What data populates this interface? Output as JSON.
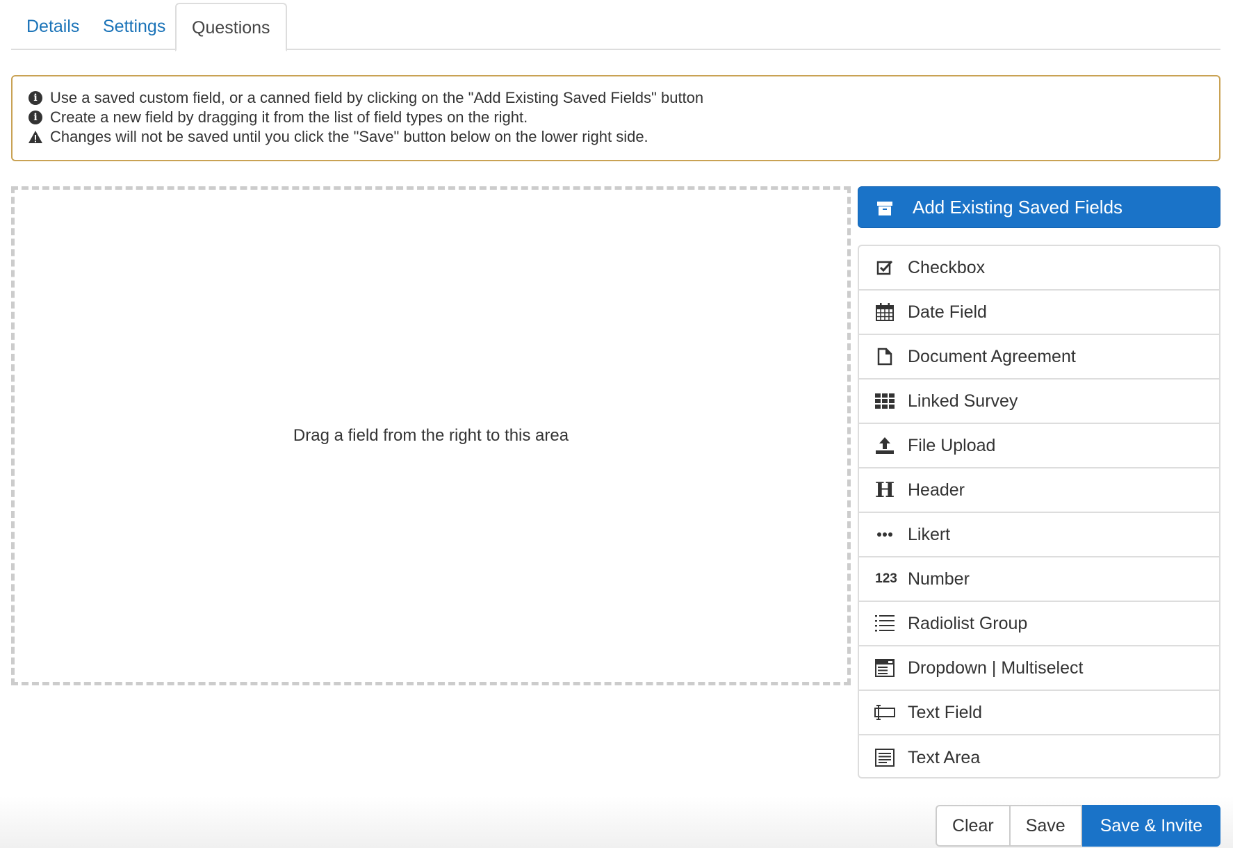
{
  "tabs": [
    {
      "label": "Details",
      "active": false
    },
    {
      "label": "Settings",
      "active": false
    },
    {
      "label": "Questions",
      "active": true
    }
  ],
  "notice": {
    "border_color": "#c9a254",
    "lines": [
      {
        "icon": "info-circle-icon",
        "text": "Use a saved custom field, or a canned field by clicking on the \"Add Existing Saved Fields\" button"
      },
      {
        "icon": "info-circle-icon",
        "text": "Create a new field by dragging it from the list of field types on the right."
      },
      {
        "icon": "warning-icon",
        "text": "Changes will not be saved until you click the \"Save\" button below on the lower right side."
      }
    ]
  },
  "dropzone": {
    "text": "Drag a field from the right to this area"
  },
  "add_existing": {
    "label": "Add Existing Saved Fields",
    "icon": "archive-icon",
    "color": "#1a73c8"
  },
  "field_types": [
    {
      "label": "Checkbox",
      "icon": "checkbox-icon"
    },
    {
      "label": "Date Field",
      "icon": "calendar-icon"
    },
    {
      "label": "Document Agreement",
      "icon": "document-icon"
    },
    {
      "label": "Linked Survey",
      "icon": "grid-icon"
    },
    {
      "label": "File Upload",
      "icon": "upload-icon"
    },
    {
      "label": "Header",
      "icon": "header-icon"
    },
    {
      "label": "Likert",
      "icon": "ellipsis-icon"
    },
    {
      "label": "Number",
      "icon": "number-icon"
    },
    {
      "label": "Radiolist Group",
      "icon": "list-icon"
    },
    {
      "label": "Dropdown | Multiselect",
      "icon": "dropdown-icon"
    },
    {
      "label": "Text Field",
      "icon": "text-field-icon"
    },
    {
      "label": "Text Area",
      "icon": "text-area-icon"
    }
  ],
  "number_icon_text": "123",
  "header_icon_text": "H",
  "footer": {
    "clear_label": "Clear",
    "save_label": "Save",
    "save_invite_label": "Save & Invite"
  }
}
